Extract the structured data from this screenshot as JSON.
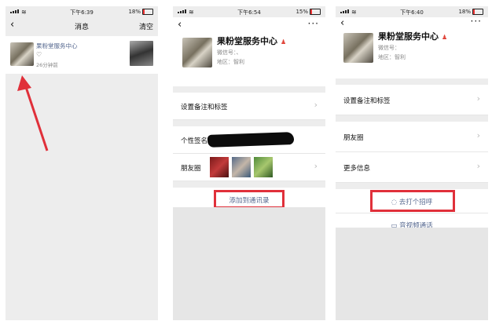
{
  "screen1": {
    "status": {
      "time": "下午6:39",
      "battery": "18%"
    },
    "nav": {
      "title": "消息",
      "right": "清空"
    },
    "message": {
      "name": "果粉堂服务中心",
      "heart": "♡",
      "time": "26分钟前"
    }
  },
  "screen2": {
    "status": {
      "time": "下午6:54",
      "battery": "15%"
    },
    "profile": {
      "name": "果粉堂服务中心",
      "wechat_label": "微信号：",
      "wechat_value": "、",
      "region_label": "地区：",
      "region_value": "智利"
    },
    "rows": {
      "remark": "设置备注和标签",
      "signature": "个性签名",
      "moments": "朋友圈"
    },
    "action": "添加到通讯录"
  },
  "screen3": {
    "status": {
      "time": "下午6:40",
      "battery": "18%"
    },
    "profile": {
      "name": "果粉堂服务中心",
      "wechat_label": "微信号：",
      "region_label": "地区：",
      "region_value": "智利"
    },
    "rows": {
      "remark": "设置备注和标签",
      "moments": "朋友圈",
      "more": "更多信息"
    },
    "actions": {
      "greet": "去打个招呼",
      "video": "音视频通话"
    }
  },
  "colors": {
    "highlight": "#e0303a",
    "link": "#56688f"
  }
}
